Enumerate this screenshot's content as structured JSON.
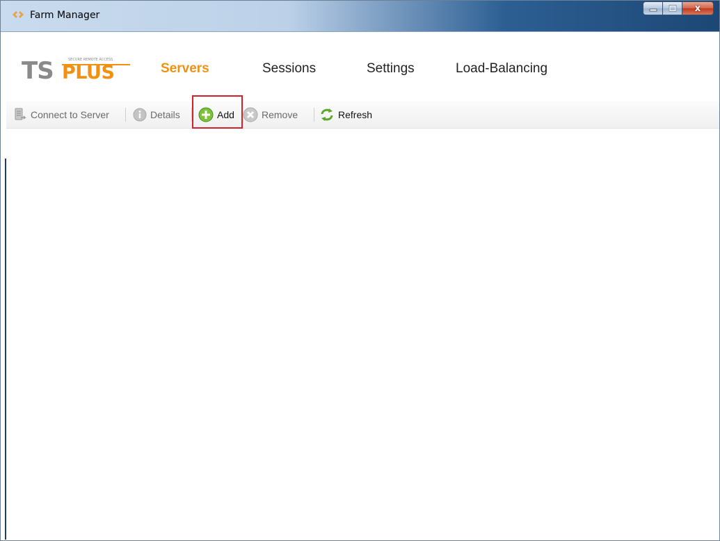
{
  "window": {
    "title": "Farm Manager",
    "caption_buttons": {
      "minimize_icon": "minimize-icon",
      "maximize_icon": "maximize-icon",
      "close_icon": "close-icon",
      "close_glyph": "x"
    }
  },
  "brand": {
    "logo_big": "TSPLUS",
    "logo_small": "SECURE REMOTE ACCESS",
    "accent_color": "#f29111"
  },
  "nav": {
    "items": [
      {
        "label": "Servers",
        "active": true
      },
      {
        "label": "Sessions",
        "active": false
      },
      {
        "label": "Settings",
        "active": false
      },
      {
        "label": "Load-Balancing",
        "active": false
      }
    ]
  },
  "toolbar": {
    "connect_label": "Connect to Server",
    "details_label": "Details",
    "add_label": "Add",
    "remove_label": "Remove",
    "refresh_label": "Refresh",
    "highlight_color": "#d4202b"
  }
}
